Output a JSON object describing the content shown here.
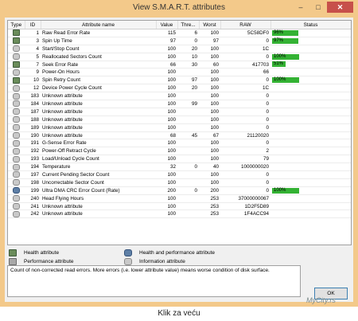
{
  "window": {
    "title": "View S.M.A.R.T. attributes",
    "minimize": "–",
    "maximize": "□",
    "close": "✕"
  },
  "table": {
    "headers": [
      "Type",
      "ID",
      "Attribute name",
      "Value",
      "Thre...",
      "Worst",
      "RAW",
      "Status"
    ],
    "rows": [
      {
        "type": "health",
        "id": "1",
        "name": "Raw Read Error Rate",
        "value": "115",
        "thr": "6",
        "worst": "100",
        "raw": "5C58DF0",
        "status": "96%",
        "pct": 96
      },
      {
        "type": "health",
        "id": "3",
        "name": "Spin Up Time",
        "value": "97",
        "thr": "0",
        "worst": "97",
        "raw": "0",
        "status": "97%",
        "pct": 97
      },
      {
        "type": "info",
        "id": "4",
        "name": "Start/Stop Count",
        "value": "100",
        "thr": "20",
        "worst": "100",
        "raw": "1C",
        "status": "",
        "pct": null
      },
      {
        "type": "info",
        "id": "5",
        "name": "Reallocated Sectors Count",
        "value": "100",
        "thr": "10",
        "worst": "100",
        "raw": "0",
        "status": "100%",
        "pct": 100
      },
      {
        "type": "health",
        "id": "7",
        "name": "Seek Error Rate",
        "value": "66",
        "thr": "30",
        "worst": "60",
        "raw": "417703",
        "status": "51%",
        "pct": 51
      },
      {
        "type": "info",
        "id": "9",
        "name": "Power-On Hours",
        "value": "100",
        "thr": "",
        "worst": "100",
        "raw": "66",
        "status": "",
        "pct": null
      },
      {
        "type": "health",
        "id": "10",
        "name": "Spin Retry Count",
        "value": "100",
        "thr": "97",
        "worst": "100",
        "raw": "0",
        "status": "100%",
        "pct": 100
      },
      {
        "type": "info",
        "id": "12",
        "name": "Device Power Cycle Count",
        "value": "100",
        "thr": "20",
        "worst": "100",
        "raw": "1C",
        "status": "",
        "pct": null
      },
      {
        "type": "info",
        "id": "183",
        "name": "Unknown attribute",
        "value": "100",
        "thr": "",
        "worst": "100",
        "raw": "0",
        "status": "",
        "pct": null
      },
      {
        "type": "info",
        "id": "184",
        "name": "Unknown attribute",
        "value": "100",
        "thr": "99",
        "worst": "100",
        "raw": "0",
        "status": "",
        "pct": null
      },
      {
        "type": "info",
        "id": "187",
        "name": "Unknown attribute",
        "value": "100",
        "thr": "",
        "worst": "100",
        "raw": "0",
        "status": "",
        "pct": null
      },
      {
        "type": "info",
        "id": "188",
        "name": "Unknown attribute",
        "value": "100",
        "thr": "",
        "worst": "100",
        "raw": "0",
        "status": "",
        "pct": null
      },
      {
        "type": "info",
        "id": "189",
        "name": "Unknown attribute",
        "value": "100",
        "thr": "",
        "worst": "100",
        "raw": "0",
        "status": "",
        "pct": null
      },
      {
        "type": "info",
        "id": "190",
        "name": "Unknown attribute",
        "value": "68",
        "thr": "45",
        "worst": "67",
        "raw": "21120020",
        "status": "",
        "pct": null
      },
      {
        "type": "info",
        "id": "191",
        "name": "G-Sense Error Rate",
        "value": "100",
        "thr": "",
        "worst": "100",
        "raw": "0",
        "status": "",
        "pct": null
      },
      {
        "type": "info",
        "id": "192",
        "name": "Power-Off Retract Cycle",
        "value": "100",
        "thr": "",
        "worst": "100",
        "raw": "2",
        "status": "",
        "pct": null
      },
      {
        "type": "info",
        "id": "193",
        "name": "Load/Unload Cycle Count",
        "value": "100",
        "thr": "",
        "worst": "100",
        "raw": "79",
        "status": "",
        "pct": null
      },
      {
        "type": "info",
        "id": "194",
        "name": "Temperature",
        "value": "32",
        "thr": "0",
        "worst": "40",
        "raw": "1000000020",
        "status": "",
        "pct": null
      },
      {
        "type": "info",
        "id": "197",
        "name": "Current Pending Sector Count",
        "value": "100",
        "thr": "",
        "worst": "100",
        "raw": "0",
        "status": "",
        "pct": null
      },
      {
        "type": "info",
        "id": "198",
        "name": "Uncorrectable Sector Count",
        "value": "100",
        "thr": "",
        "worst": "100",
        "raw": "0",
        "status": "",
        "pct": null
      },
      {
        "type": "hp",
        "id": "199",
        "name": "Ultra DMA CRC Error Count (Rate)",
        "value": "200",
        "thr": "0",
        "worst": "200",
        "raw": "0",
        "status": "100%",
        "pct": 100
      },
      {
        "type": "info",
        "id": "240",
        "name": "Head Flying Hours",
        "value": "100",
        "thr": "",
        "worst": "253",
        "raw": "37000000067",
        "status": "",
        "pct": null
      },
      {
        "type": "info",
        "id": "241",
        "name": "Unknown attribute",
        "value": "100",
        "thr": "",
        "worst": "253",
        "raw": "1D2F5D89",
        "status": "",
        "pct": null
      },
      {
        "type": "info",
        "id": "242",
        "name": "Unknown attribute",
        "value": "100",
        "thr": "",
        "worst": "253",
        "raw": "1F4ACC94",
        "status": "",
        "pct": null
      }
    ]
  },
  "legend": {
    "health": "Health attribute",
    "health_perf": "Health and performance attribute",
    "performance": "Performance attribute",
    "information": "Information attribute"
  },
  "description": "Count of non-corrected read errors. More errors (i.e. lower attribute value) means worse condition of disk surface.",
  "ok_label": "OK",
  "caption": "Klik za veću",
  "watermark": "MyCity.rs",
  "colors": {
    "window_frame": "#f3c98a",
    "status_fill": "#34b234",
    "close_button": "#c7504a"
  }
}
